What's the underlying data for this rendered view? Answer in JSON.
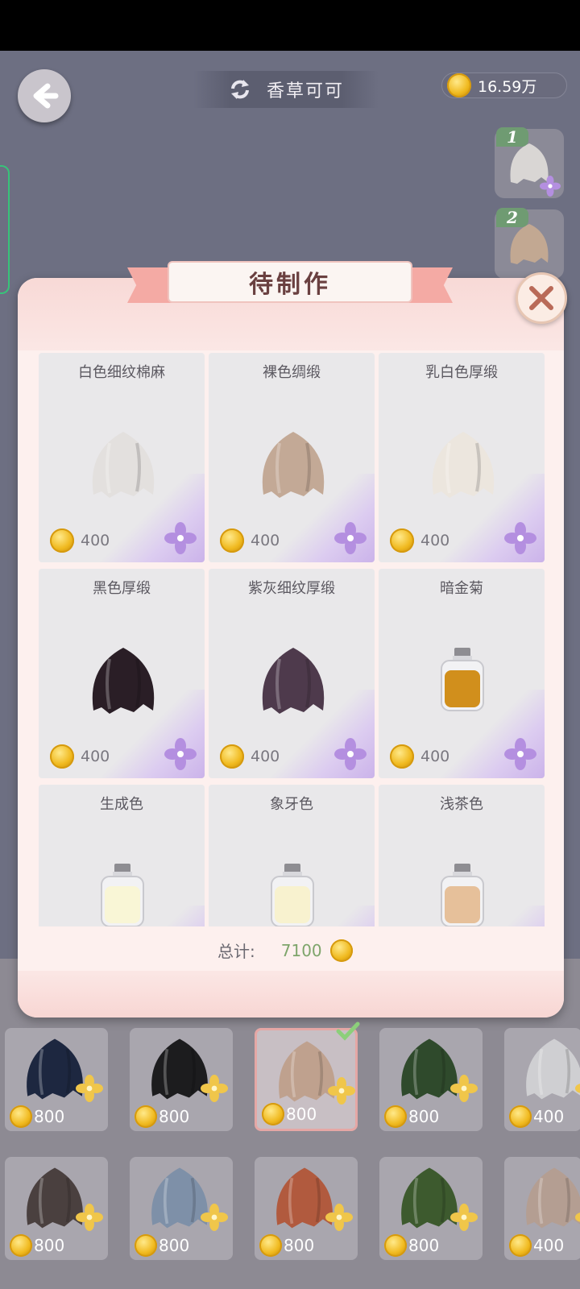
{
  "header": {
    "title": "香草可可",
    "currency_amount": "16.59万"
  },
  "queue": [
    {
      "num": "1"
    },
    {
      "num": "2"
    }
  ],
  "dialog": {
    "title": "待制作",
    "items": [
      {
        "name": "白色细纹棉麻",
        "price": "400",
        "kind": "cloth",
        "color": "#e3e0de"
      },
      {
        "name": "裸色绸缎",
        "price": "400",
        "kind": "cloth",
        "color": "#c3a996"
      },
      {
        "name": "乳白色厚缎",
        "price": "400",
        "kind": "cloth",
        "color": "#ece6de"
      },
      {
        "name": "黑色厚缎",
        "price": "400",
        "kind": "cloth",
        "color": "#2a1e26"
      },
      {
        "name": "紫灰细纹厚缎",
        "price": "400",
        "kind": "cloth",
        "color": "#4e3a4c"
      },
      {
        "name": "暗金菊",
        "price": "400",
        "kind": "bottle",
        "color": "#d18f1c"
      },
      {
        "name": "生成色",
        "price": "",
        "kind": "bottle",
        "color": "#f9f6d6"
      },
      {
        "name": "象牙色",
        "price": "",
        "kind": "bottle",
        "color": "#f8f2cf"
      },
      {
        "name": "浅茶色",
        "price": "",
        "kind": "bottle",
        "color": "#e6c09a"
      }
    ],
    "total_label": "总计:",
    "total_value": "7100"
  },
  "shop": [
    {
      "price": "800",
      "color": "#1d2740",
      "selected": false
    },
    {
      "price": "800",
      "color": "#1c1c1e",
      "selected": false
    },
    {
      "price": "800",
      "color": "#bfa18e",
      "selected": true
    },
    {
      "price": "800",
      "color": "#2f4a2c",
      "selected": false
    },
    {
      "price": "400",
      "color": "#cfcfd2",
      "selected": false
    },
    {
      "price": "800",
      "color": "#4a403f",
      "selected": false
    },
    {
      "price": "800",
      "color": "#7e90a8",
      "selected": false
    },
    {
      "price": "800",
      "color": "#b15a3e",
      "selected": false
    },
    {
      "price": "800",
      "color": "#3d5a2e",
      "selected": false
    },
    {
      "price": "400",
      "color": "#b49e92",
      "selected": false
    }
  ],
  "icons": {
    "back": "back-arrow-icon",
    "refresh": "refresh-icon",
    "close": "close-icon",
    "coin": "gold-coin-icon",
    "purple_flower": "purple-flower-icon",
    "gold_flower": "gold-flower-icon",
    "check": "check-icon"
  }
}
